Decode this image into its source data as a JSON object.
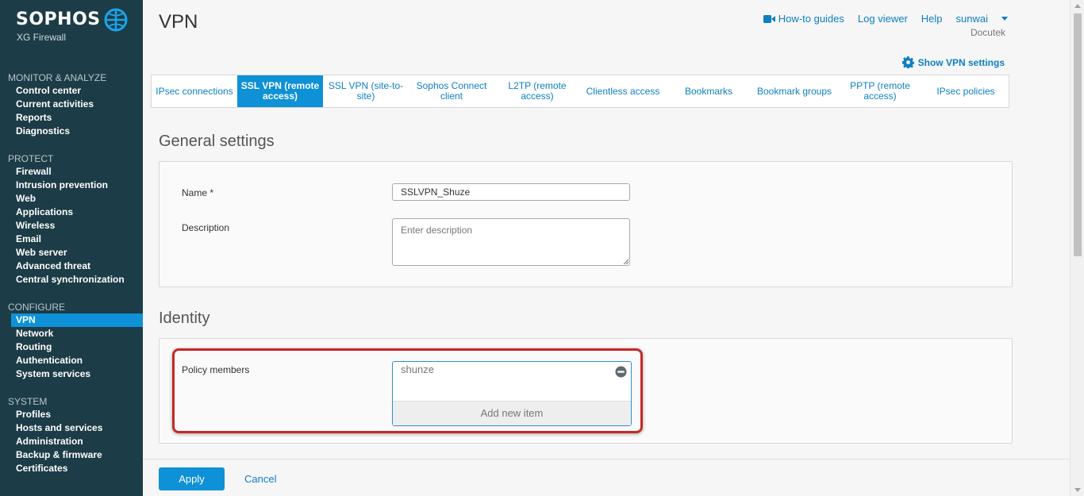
{
  "brand": {
    "name": "SOPHOS",
    "product": "XG Firewall"
  },
  "sidebar": {
    "sections": [
      {
        "heading": "MONITOR & ANALYZE",
        "items": [
          "Control center",
          "Current activities",
          "Reports",
          "Diagnostics"
        ]
      },
      {
        "heading": "PROTECT",
        "items": [
          "Firewall",
          "Intrusion prevention",
          "Web",
          "Applications",
          "Wireless",
          "Email",
          "Web server",
          "Advanced threat",
          "Central synchronization"
        ]
      },
      {
        "heading": "CONFIGURE",
        "items": [
          "VPN",
          "Network",
          "Routing",
          "Authentication",
          "System services"
        ]
      },
      {
        "heading": "SYSTEM",
        "items": [
          "Profiles",
          "Hosts and services",
          "Administration",
          "Backup & firmware",
          "Certificates"
        ]
      }
    ],
    "active_item": "VPN"
  },
  "header": {
    "title": "VPN",
    "links": {
      "guides": "How-to guides",
      "log_viewer": "Log viewer",
      "help": "Help",
      "user": "sunwai"
    },
    "org": "Docutek",
    "vpn_settings": "Show VPN settings"
  },
  "tabs": [
    {
      "label": "IPsec connections",
      "active": false
    },
    {
      "label": "SSL VPN (remote access)",
      "active": true
    },
    {
      "label": "SSL VPN (site-to-site)",
      "active": false
    },
    {
      "label": "Sophos Connect client",
      "active": false
    },
    {
      "label": "L2TP (remote access)",
      "active": false
    },
    {
      "label": "Clientless access",
      "active": false
    },
    {
      "label": "Bookmarks",
      "active": false
    },
    {
      "label": "Bookmark groups",
      "active": false
    },
    {
      "label": "PPTP (remote access)",
      "active": false
    },
    {
      "label": "IPsec policies",
      "active": false
    }
  ],
  "general": {
    "title": "General settings",
    "name_label": "Name *",
    "name_value": "SSLVPN_Shuze",
    "description_label": "Description",
    "description_placeholder": "Enter description"
  },
  "identity": {
    "title": "Identity",
    "members_label": "Policy members",
    "members": [
      "shunze"
    ],
    "add_item": "Add new item"
  },
  "footer": {
    "apply": "Apply",
    "cancel": "Cancel"
  },
  "colors": {
    "sidebar_bg": "#1c3c47",
    "accent": "#0e91d6",
    "link": "#0e7fc2",
    "highlight": "#c62828"
  }
}
